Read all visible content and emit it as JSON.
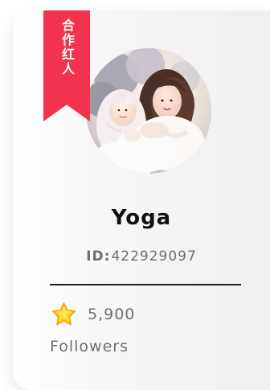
{
  "profile_card": {
    "ribbon_label": "合作红人",
    "name": "Yoga",
    "id_label": "ID:",
    "id_value": "422929097",
    "followers_count": "5,900",
    "followers_label": "Followers",
    "icons": {
      "star": "star-icon"
    },
    "colors": {
      "ribbon": "#f2334d",
      "text_primary": "#111111",
      "text_secondary": "#6f6f6f",
      "star_fill": "#ffd21f",
      "star_outline": "#f3a900"
    }
  }
}
